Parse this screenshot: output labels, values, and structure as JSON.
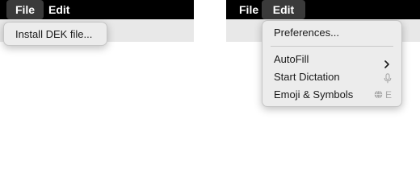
{
  "left": {
    "menubar": {
      "file": "File",
      "edit": "Edit"
    },
    "menu": {
      "items": [
        "Install DEK file..."
      ]
    }
  },
  "right": {
    "menubar": {
      "file": "File",
      "edit": "Edit"
    },
    "menu": {
      "items": [
        {
          "label": "Preferences..."
        },
        {
          "label": "AutoFill",
          "icon": "chevron-right-icon"
        },
        {
          "label": "Start Dictation",
          "icon": "microphone-icon"
        },
        {
          "label": "Emoji & Symbols",
          "icon": "globe-icon",
          "shortcut": "E"
        }
      ]
    }
  },
  "colors": {
    "menubar": "#000000",
    "active_menubar_item": "#3a3a3a",
    "menu_background": "#ececec",
    "shortcut_text": "#a9a9a9"
  }
}
